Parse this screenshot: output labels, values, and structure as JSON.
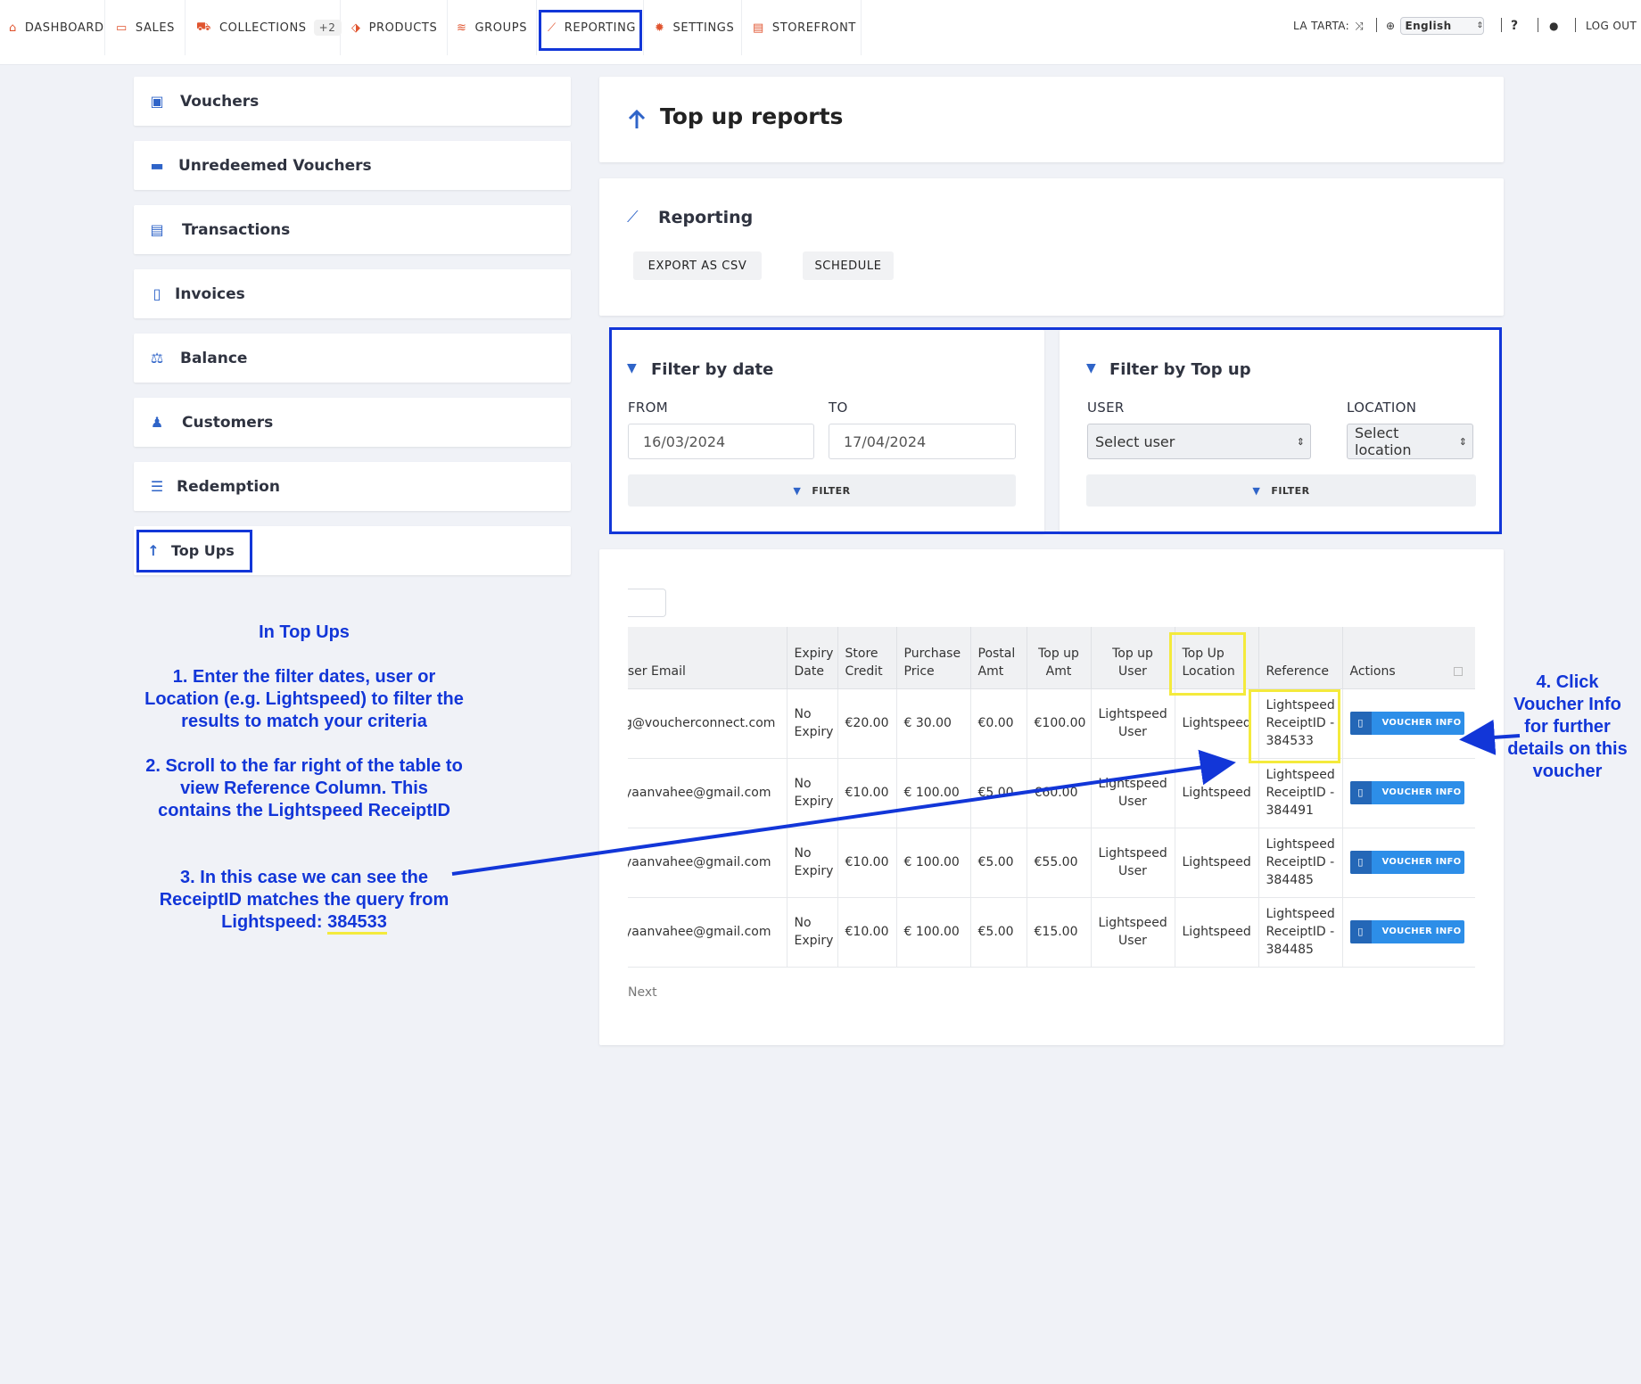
{
  "nav": {
    "items": [
      {
        "label": "DASHBOARD",
        "icon": "home-icon",
        "glyph": "⌂"
      },
      {
        "label": "SALES",
        "icon": "cash-icon",
        "glyph": "▭"
      },
      {
        "label": "COLLECTIONS",
        "icon": "truck-icon",
        "glyph": "⛟",
        "badge": "+2"
      },
      {
        "label": "PRODUCTS",
        "icon": "tag-icon",
        "glyph": "⬗"
      },
      {
        "label": "GROUPS",
        "icon": "layers-icon",
        "glyph": "≋"
      },
      {
        "label": "REPORTING",
        "icon": "chart-icon",
        "glyph": "⟋"
      },
      {
        "label": "SETTINGS",
        "icon": "gear-icon",
        "glyph": "✹"
      },
      {
        "label": "STOREFRONT",
        "icon": "store-icon",
        "glyph": "▤"
      }
    ],
    "account": "LA TARTA:",
    "language": "English",
    "help": "?",
    "logout": "LOG OUT"
  },
  "sidebar": {
    "items": [
      {
        "label": "Vouchers",
        "icon": "voucher-icon",
        "glyph": "▣"
      },
      {
        "label": "Unredeemed Vouchers",
        "icon": "card-icon",
        "glyph": "▬"
      },
      {
        "label": "Transactions",
        "icon": "receipt-icon",
        "glyph": "▤"
      },
      {
        "label": "Invoices",
        "icon": "document-icon",
        "glyph": "▯"
      },
      {
        "label": "Balance",
        "icon": "scale-icon",
        "glyph": "⚖"
      },
      {
        "label": "Customers",
        "icon": "users-icon",
        "glyph": "♟"
      },
      {
        "label": "Redemption",
        "icon": "list-icon",
        "glyph": "☰"
      },
      {
        "label": "Top Ups",
        "icon": "arrow-up-icon",
        "glyph": "↑"
      }
    ]
  },
  "page": {
    "title": "Top up reports",
    "reporting_title": "Reporting",
    "export_label": "EXPORT AS CSV",
    "schedule_label": "SCHEDULE"
  },
  "filter_date": {
    "title": "Filter by date",
    "from_label": "FROM",
    "to_label": "TO",
    "from_value": "16/03/2024",
    "to_value": "17/04/2024",
    "button": "FILTER"
  },
  "filter_topup": {
    "title": "Filter by Top up",
    "user_label": "USER",
    "location_label": "LOCATION",
    "user_placeholder": "Select user",
    "location_placeholder": "Select location",
    "button": "FILTER"
  },
  "table": {
    "headers": {
      "email": "ıser Email",
      "expiry": "Expiry Date",
      "store_credit": "Store Credit",
      "purchase": "Purchase Price",
      "postal": "Postal Amt",
      "topup_amt": "Top up Amt",
      "topup_user": "Top up User",
      "topup_location": "Top Up Location",
      "reference": "Reference",
      "actions": "Actions"
    },
    "rows": [
      {
        "email": "g@voucherconnect.com",
        "expiry": "No Expiry",
        "store_credit": "€20.00",
        "purchase": "€ 30.00",
        "postal": "€0.00",
        "topup_amt": "€100.00",
        "topup_user": "Lightspeed User",
        "location": "Lightspeed",
        "reference": "Lightspeed ReceiptID - 384533",
        "action": "VOUCHER INFO"
      },
      {
        "email": "yaanvahee@gmail.com",
        "expiry": "No Expiry",
        "store_credit": "€10.00",
        "purchase": "€ 100.00",
        "postal": "€5.00",
        "topup_amt": "€60.00",
        "topup_user": "Lightspeed User",
        "location": "Lightspeed",
        "reference": "Lightspeed ReceiptID - 384491",
        "action": "VOUCHER INFO"
      },
      {
        "email": "yaanvahee@gmail.com",
        "expiry": "No Expiry",
        "store_credit": "€10.00",
        "purchase": "€ 100.00",
        "postal": "€5.00",
        "topup_amt": "€55.00",
        "topup_user": "Lightspeed User",
        "location": "Lightspeed",
        "reference": "Lightspeed ReceiptID - 384485",
        "action": "VOUCHER INFO"
      },
      {
        "email": "yaanvahee@gmail.com",
        "expiry": "No Expiry",
        "store_credit": "€10.00",
        "purchase": "€ 100.00",
        "postal": "€5.00",
        "topup_amt": "€15.00",
        "topup_user": "Lightspeed User",
        "location": "Lightspeed",
        "reference": "Lightspeed ReceiptID - 384485",
        "action": "VOUCHER INFO"
      }
    ],
    "next_label": "Next"
  },
  "annotations": {
    "heading": "In Top Ups",
    "step1": "1. Enter the filter dates, user or Location (e.g. Lightspeed) to filter the results to match your criteria",
    "step2": "2. Scroll to the far right of the table to view Reference Column. This contains the Lightspeed ReceiptID",
    "step3_prefix": "3. In this case we can see the ReceiptID matches the query from Lightspeed:",
    "step3_id": "384533",
    "step4": "4. Click Voucher Info for further details on this voucher"
  },
  "colors": {
    "accent": "#e0542f",
    "highlight_blue": "#1236d8",
    "highlight_yellow": "#f4ea3c",
    "button_blue": "#2d8ee8",
    "icon_blue": "#2f64c8"
  }
}
